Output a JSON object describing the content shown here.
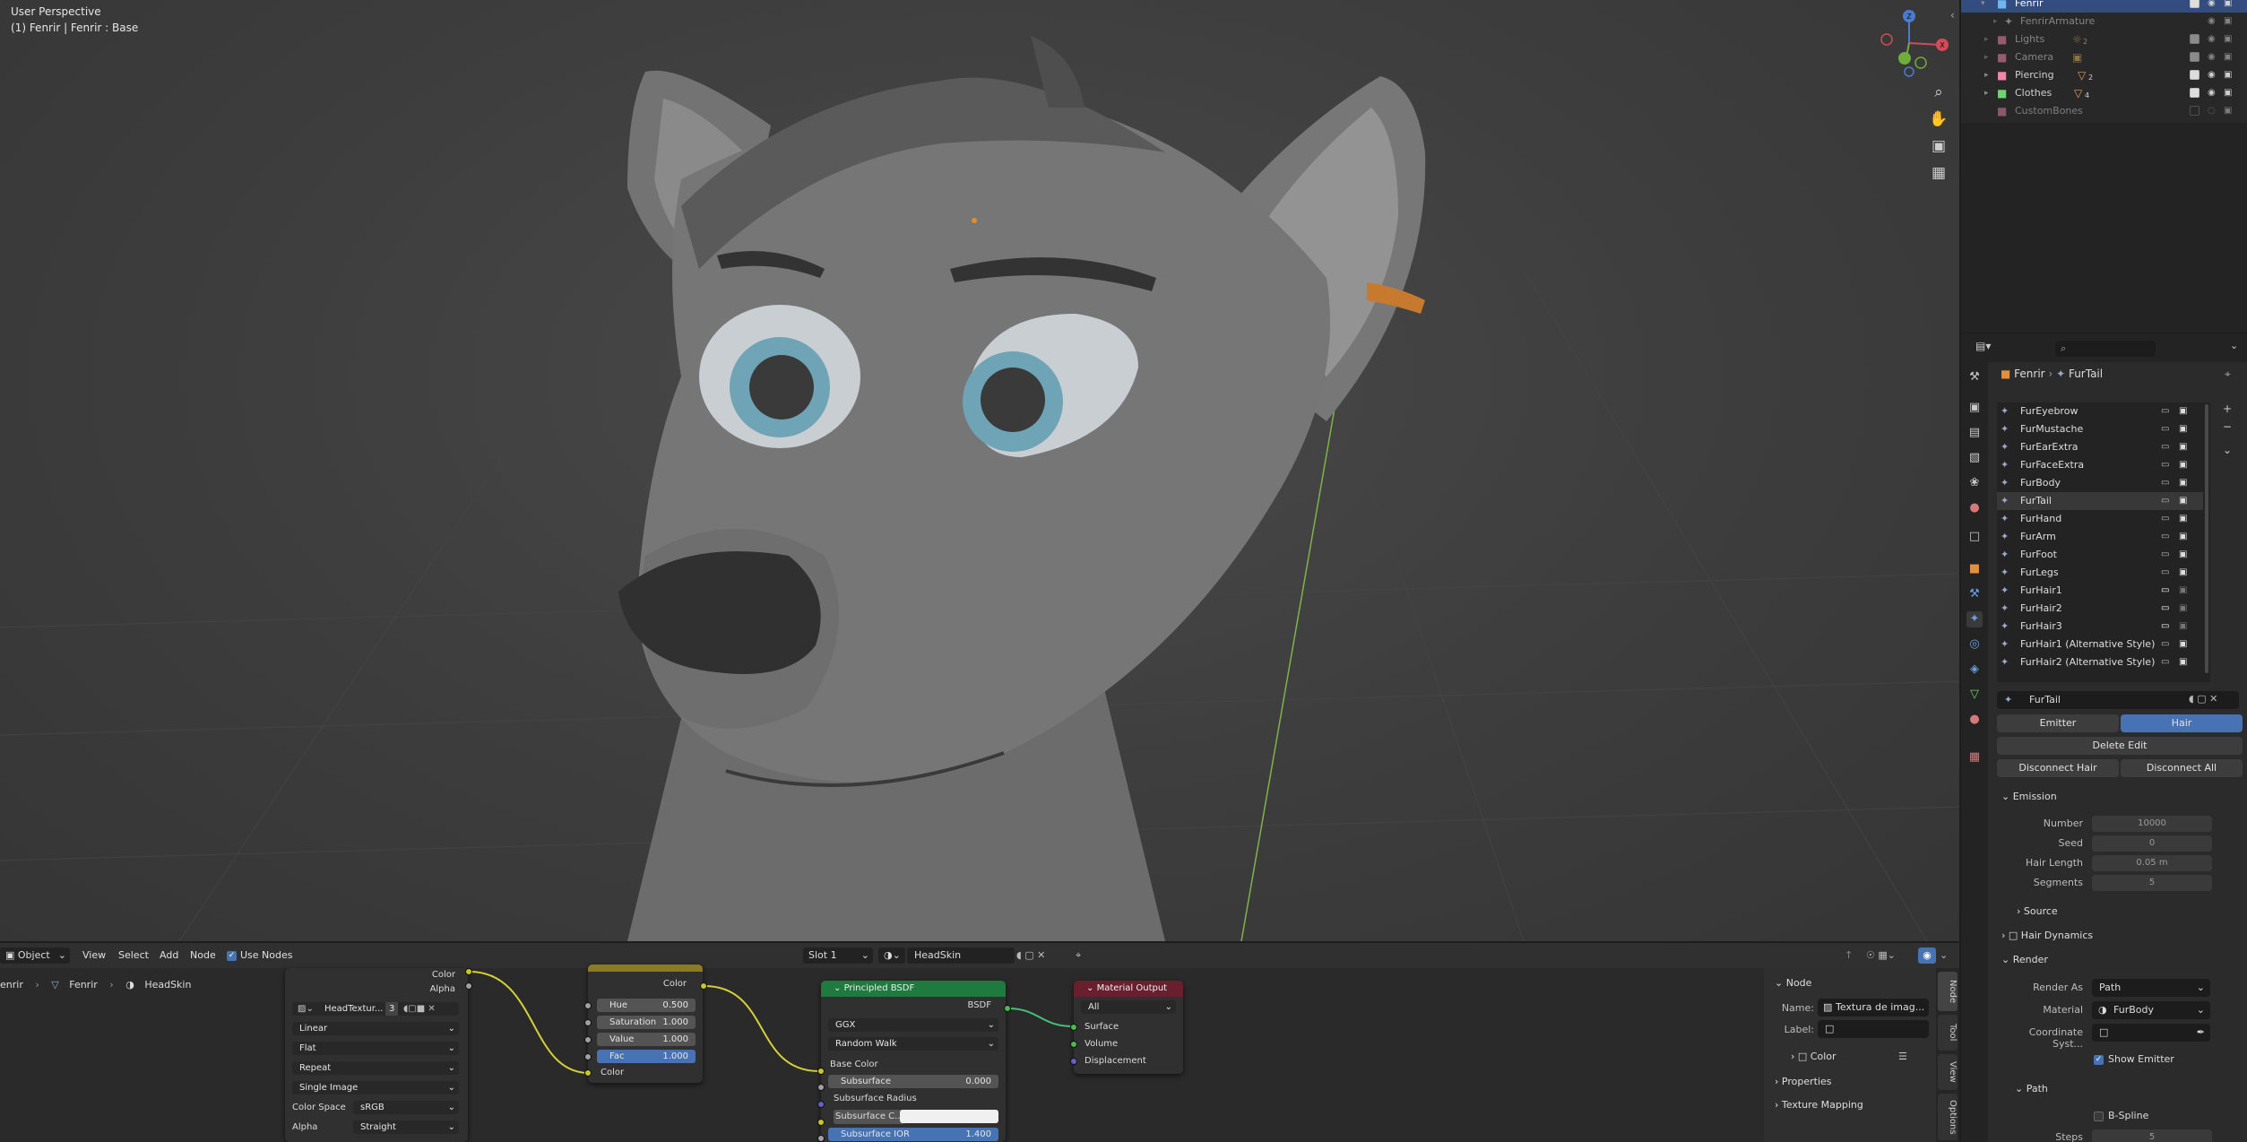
{
  "viewport": {
    "perspective_label": "User Perspective",
    "object_label": "(1) Fenrir | Fenrir : Base"
  },
  "outliner": {
    "items": [
      {
        "name": "Fenrir",
        "badge": ""
      },
      {
        "name": "FenrirArmature",
        "badge": ""
      },
      {
        "name": "Lights",
        "badge": "2"
      },
      {
        "name": "Camera",
        "badge": ""
      },
      {
        "name": "Piercing",
        "badge": "2"
      },
      {
        "name": "Clothes",
        "badge": "4"
      },
      {
        "name": "CustomBones",
        "badge": ""
      }
    ]
  },
  "properties": {
    "breadcrumb": {
      "object": "Fenrir",
      "system": "FurTail"
    },
    "particle_systems": [
      "FurEyebrow",
      "FurMustache",
      "FurEarExtra",
      "FurFaceExtra",
      "FurBody",
      "FurTail",
      "FurHand",
      "FurArm",
      "FurFoot",
      "FurLegs",
      "FurHair1",
      "FurHair2",
      "FurHair3",
      "FurHair1 (Alternative Style)",
      "FurHair2 (Alternative Style)"
    ],
    "selected_system": "FurTail",
    "settings_name": "FurTail",
    "type_tabs": {
      "emitter": "Emitter",
      "hair": "Hair"
    },
    "delete_edit": "Delete Edit",
    "disconnect_hair": "Disconnect Hair",
    "disconnect_all": "Disconnect All",
    "emission": {
      "title": "Emission",
      "number_label": "Number",
      "number_value": "10000",
      "seed_label": "Seed",
      "seed_value": "0",
      "hair_length_label": "Hair Length",
      "hair_length_value": "0.05 m",
      "segments_label": "Segments",
      "segments_value": "5"
    },
    "source_title": "Source",
    "hair_dynamics_title": "Hair Dynamics",
    "render": {
      "title": "Render",
      "render_as_label": "Render As",
      "render_as_value": "Path",
      "material_label": "Material",
      "material_value": "FurBody",
      "coord_label": "Coordinate Syst...",
      "show_emitter_label": "Show Emitter"
    },
    "path": {
      "title": "Path",
      "bspline_label": "B-Spline",
      "steps_label": "Steps",
      "steps_value": "5"
    }
  },
  "node_editor": {
    "header": {
      "mode": "Object",
      "menu_view": "View",
      "menu_select": "Select",
      "menu_add": "Add",
      "menu_node": "Node",
      "use_nodes_label": "Use Nodes",
      "slot": "Slot 1",
      "material": "HeadSkin"
    },
    "breadcrumb": {
      "a": "enrir",
      "b": "Fenrir",
      "c": "HeadSkin"
    },
    "image_node": {
      "out_color": "Color",
      "out_alpha": "Alpha",
      "image_name": "HeadTextur...",
      "users": "3",
      "interpolation": "Linear",
      "projection": "Flat",
      "extension": "Repeat",
      "source": "Single Image",
      "color_space_label": "Color Space",
      "color_space_value": "sRGB",
      "alpha_label": "Alpha",
      "alpha_value": "Straight"
    },
    "hsv_node": {
      "out_color": "Color",
      "hue_label": "Hue",
      "hue_value": "0.500",
      "sat_label": "Saturation",
      "sat_value": "1.000",
      "val_label": "Value",
      "val_value": "1.000",
      "fac_label": "Fac",
      "fac_value": "1.000",
      "in_color": "Color"
    },
    "bsdf_node": {
      "title": "Principled BSDF",
      "out_bsdf": "BSDF",
      "distribution": "GGX",
      "subsurface_method": "Random Walk",
      "base_color": "Base Color",
      "subsurface_label": "Subsurface",
      "subsurface_value": "0.000",
      "subsurface_radius": "Subsurface Radius",
      "subsurface_color": "Subsurface C...",
      "subsurface_ior_label": "Subsurface IOR",
      "subsurface_ior_value": "1.400"
    },
    "output_node": {
      "title": "Material Output",
      "target": "All",
      "surface": "Surface",
      "volume": "Volume",
      "displacement": "Displacement"
    },
    "side_panel": {
      "node_section": "Node",
      "name_label": "Name:",
      "name_value": "Textura de imag...",
      "label_label": "Label:",
      "color_section": "Color",
      "properties_section": "Properties",
      "texture_mapping_section": "Texture Mapping",
      "tabs": [
        "Node",
        "Tool",
        "View",
        "Options"
      ]
    }
  },
  "colors": {
    "accent_blue": "#4772b3",
    "bsdf_header": "#1f7a3f",
    "output_header": "#6a1f2e",
    "hsv_header": "#8a7b24",
    "socket_yellow": "#c7c729",
    "socket_green": "#4cb94c",
    "socket_purple": "#6363c7",
    "socket_grey": "#a1a1a1",
    "link_yellow": "#d4d03a",
    "link_green": "#44c07a"
  }
}
